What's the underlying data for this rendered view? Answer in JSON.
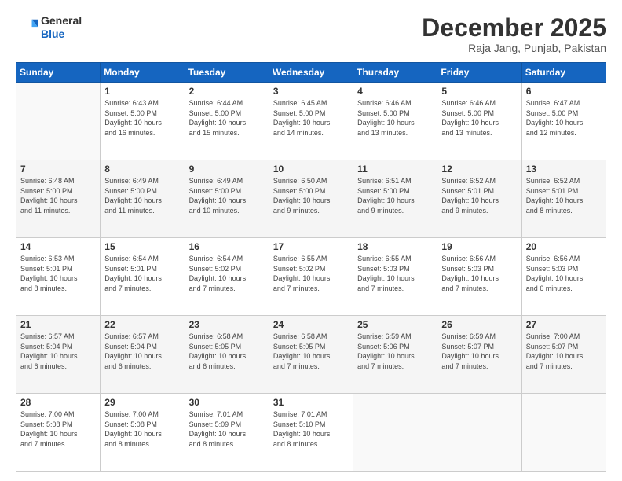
{
  "header": {
    "logo_line1": "General",
    "logo_line2": "Blue",
    "month": "December 2025",
    "location": "Raja Jang, Punjab, Pakistan"
  },
  "weekdays": [
    "Sunday",
    "Monday",
    "Tuesday",
    "Wednesday",
    "Thursday",
    "Friday",
    "Saturday"
  ],
  "weeks": [
    [
      {
        "day": "",
        "info": ""
      },
      {
        "day": "1",
        "info": "Sunrise: 6:43 AM\nSunset: 5:00 PM\nDaylight: 10 hours\nand 16 minutes."
      },
      {
        "day": "2",
        "info": "Sunrise: 6:44 AM\nSunset: 5:00 PM\nDaylight: 10 hours\nand 15 minutes."
      },
      {
        "day": "3",
        "info": "Sunrise: 6:45 AM\nSunset: 5:00 PM\nDaylight: 10 hours\nand 14 minutes."
      },
      {
        "day": "4",
        "info": "Sunrise: 6:46 AM\nSunset: 5:00 PM\nDaylight: 10 hours\nand 13 minutes."
      },
      {
        "day": "5",
        "info": "Sunrise: 6:46 AM\nSunset: 5:00 PM\nDaylight: 10 hours\nand 13 minutes."
      },
      {
        "day": "6",
        "info": "Sunrise: 6:47 AM\nSunset: 5:00 PM\nDaylight: 10 hours\nand 12 minutes."
      }
    ],
    [
      {
        "day": "7",
        "info": "Sunrise: 6:48 AM\nSunset: 5:00 PM\nDaylight: 10 hours\nand 11 minutes."
      },
      {
        "day": "8",
        "info": "Sunrise: 6:49 AM\nSunset: 5:00 PM\nDaylight: 10 hours\nand 11 minutes."
      },
      {
        "day": "9",
        "info": "Sunrise: 6:49 AM\nSunset: 5:00 PM\nDaylight: 10 hours\nand 10 minutes."
      },
      {
        "day": "10",
        "info": "Sunrise: 6:50 AM\nSunset: 5:00 PM\nDaylight: 10 hours\nand 9 minutes."
      },
      {
        "day": "11",
        "info": "Sunrise: 6:51 AM\nSunset: 5:00 PM\nDaylight: 10 hours\nand 9 minutes."
      },
      {
        "day": "12",
        "info": "Sunrise: 6:52 AM\nSunset: 5:01 PM\nDaylight: 10 hours\nand 9 minutes."
      },
      {
        "day": "13",
        "info": "Sunrise: 6:52 AM\nSunset: 5:01 PM\nDaylight: 10 hours\nand 8 minutes."
      }
    ],
    [
      {
        "day": "14",
        "info": "Sunrise: 6:53 AM\nSunset: 5:01 PM\nDaylight: 10 hours\nand 8 minutes."
      },
      {
        "day": "15",
        "info": "Sunrise: 6:54 AM\nSunset: 5:01 PM\nDaylight: 10 hours\nand 7 minutes."
      },
      {
        "day": "16",
        "info": "Sunrise: 6:54 AM\nSunset: 5:02 PM\nDaylight: 10 hours\nand 7 minutes."
      },
      {
        "day": "17",
        "info": "Sunrise: 6:55 AM\nSunset: 5:02 PM\nDaylight: 10 hours\nand 7 minutes."
      },
      {
        "day": "18",
        "info": "Sunrise: 6:55 AM\nSunset: 5:03 PM\nDaylight: 10 hours\nand 7 minutes."
      },
      {
        "day": "19",
        "info": "Sunrise: 6:56 AM\nSunset: 5:03 PM\nDaylight: 10 hours\nand 7 minutes."
      },
      {
        "day": "20",
        "info": "Sunrise: 6:56 AM\nSunset: 5:03 PM\nDaylight: 10 hours\nand 6 minutes."
      }
    ],
    [
      {
        "day": "21",
        "info": "Sunrise: 6:57 AM\nSunset: 5:04 PM\nDaylight: 10 hours\nand 6 minutes."
      },
      {
        "day": "22",
        "info": "Sunrise: 6:57 AM\nSunset: 5:04 PM\nDaylight: 10 hours\nand 6 minutes."
      },
      {
        "day": "23",
        "info": "Sunrise: 6:58 AM\nSunset: 5:05 PM\nDaylight: 10 hours\nand 6 minutes."
      },
      {
        "day": "24",
        "info": "Sunrise: 6:58 AM\nSunset: 5:05 PM\nDaylight: 10 hours\nand 7 minutes."
      },
      {
        "day": "25",
        "info": "Sunrise: 6:59 AM\nSunset: 5:06 PM\nDaylight: 10 hours\nand 7 minutes."
      },
      {
        "day": "26",
        "info": "Sunrise: 6:59 AM\nSunset: 5:07 PM\nDaylight: 10 hours\nand 7 minutes."
      },
      {
        "day": "27",
        "info": "Sunrise: 7:00 AM\nSunset: 5:07 PM\nDaylight: 10 hours\nand 7 minutes."
      }
    ],
    [
      {
        "day": "28",
        "info": "Sunrise: 7:00 AM\nSunset: 5:08 PM\nDaylight: 10 hours\nand 7 minutes."
      },
      {
        "day": "29",
        "info": "Sunrise: 7:00 AM\nSunset: 5:08 PM\nDaylight: 10 hours\nand 8 minutes."
      },
      {
        "day": "30",
        "info": "Sunrise: 7:01 AM\nSunset: 5:09 PM\nDaylight: 10 hours\nand 8 minutes."
      },
      {
        "day": "31",
        "info": "Sunrise: 7:01 AM\nSunset: 5:10 PM\nDaylight: 10 hours\nand 8 minutes."
      },
      {
        "day": "",
        "info": ""
      },
      {
        "day": "",
        "info": ""
      },
      {
        "day": "",
        "info": ""
      }
    ]
  ]
}
